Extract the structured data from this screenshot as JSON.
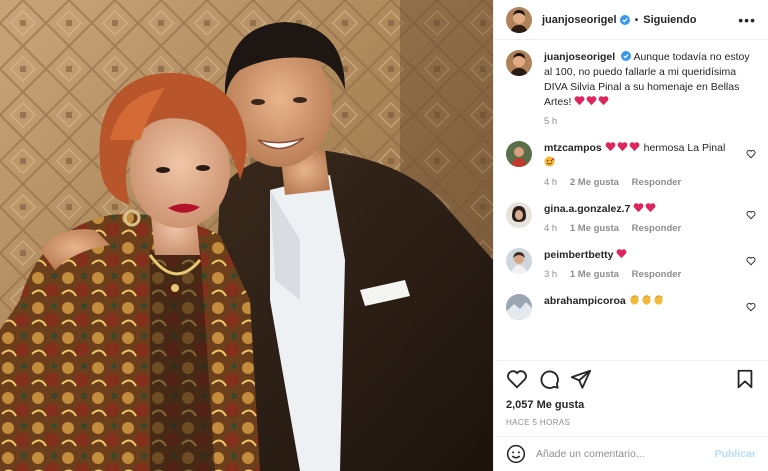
{
  "header": {
    "username": "juanjoseorigel",
    "separator": "•",
    "follow_status": "Siguiendo",
    "more_label": "•••"
  },
  "caption": {
    "username": "juanjoseorigel",
    "text": "Aunque todavía no estoy al 100, no puedo fallarle a mi queridísima DIVA Silvia Pinal a su homenaje en Bellas Artes!",
    "emoji": [
      "heart",
      "heart",
      "heart"
    ],
    "time": "5 h"
  },
  "comments": [
    {
      "username": "mtzcampos",
      "text_before": "",
      "text_after": "hermosa La Pinal",
      "emoji_before": [
        "heart",
        "heart",
        "heart"
      ],
      "emoji_after": [
        "smiling-face-with-hearts"
      ],
      "time": "4 h",
      "likes": "2 Me gusta",
      "reply": "Responder"
    },
    {
      "username": "gina.a.gonzalez.7",
      "text_after": "",
      "emoji_before": [
        "heart",
        "heart"
      ],
      "time": "4 h",
      "likes": "1 Me gusta",
      "reply": "Responder"
    },
    {
      "username": "peimbertbetty",
      "text_after": "",
      "emoji_before": [
        "heart"
      ],
      "time": "3 h",
      "likes": "1 Me gusta",
      "reply": "Responder"
    },
    {
      "username": "abrahampicoroa",
      "text_after": "",
      "emoji_before": [
        "clapping-hands",
        "clapping-hands",
        "clapping-hands"
      ]
    }
  ],
  "actions": {
    "like_icon": "heart-outline-icon",
    "comment_icon": "comment-icon",
    "share_icon": "paper-plane-icon",
    "save_icon": "bookmark-icon"
  },
  "likes_count": "2,057 Me gusta",
  "posted_ago": "HACE 5 HORAS",
  "add_comment": {
    "placeholder": "Añade un comentario...",
    "publish_label": "Publicar"
  },
  "colors": {
    "heart_red": "#ed4956",
    "verified_blue": "#3897f0",
    "publish_disabled": "#b2dffc",
    "muted_text": "#8e8e8e"
  }
}
